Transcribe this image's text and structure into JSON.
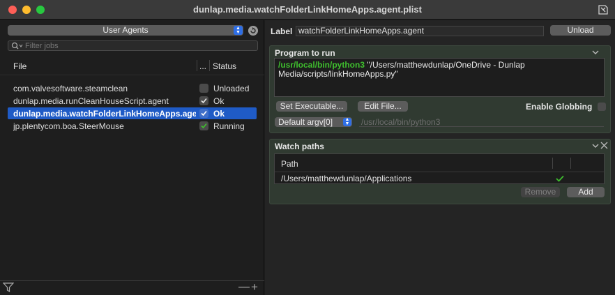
{
  "window": {
    "title": "dunlap.media.watchFolderLinkHomeApps.agent.plist"
  },
  "colors": {
    "selection": "#1f5bc6",
    "executable_green": "#3fbf2e",
    "panel_green": "#303a31",
    "popup_accent": "#2e6ee6"
  },
  "sidebar": {
    "agent_type": "User Agents",
    "filter_placeholder": "Filter jobs",
    "columns": {
      "file": "File",
      "flag": "...",
      "status": "Status"
    },
    "jobs": [
      {
        "label": "com.valvesoftware.steamclean",
        "checked": false,
        "status": "Unloaded",
        "selected": false
      },
      {
        "label": "dunlap.media.runCleanHouseScript.agent",
        "checked": true,
        "status": "Ok",
        "selected": false
      },
      {
        "label": "dunlap.media.watchFolderLinkHomeApps.agent",
        "checked": true,
        "status": "Ok",
        "selected": true
      },
      {
        "label": "jp.plentycom.boa.SteerMouse",
        "checked": true,
        "status": "Running",
        "selected": false
      }
    ],
    "footer": {
      "remove_symbol": "—",
      "add_symbol": "+"
    }
  },
  "detail": {
    "label_title": "Label",
    "label_value": "watchFolderLinkHomeApps.agent",
    "unload_button": "Unload",
    "program": {
      "title": "Program to run",
      "executable": "/usr/local/bin/python3",
      "arguments": " \"/Users/matthewdunlap/OneDrive - Dunlap Media/scripts/linkHomeApps.py\"",
      "set_executable_button": "Set Executable...",
      "edit_file_button": "Edit File...",
      "globbing_label": "Enable Globbing",
      "globbing_enabled": false,
      "argv_option": "Default argv[0]",
      "argv_value": "/usr/local/bin/python3"
    },
    "watch": {
      "title": "Watch paths",
      "column_path": "Path",
      "paths": [
        {
          "path": "/Users/matthewdunlap/Applications",
          "ok": true
        }
      ],
      "remove_button": "Remove",
      "add_button": "Add"
    }
  }
}
